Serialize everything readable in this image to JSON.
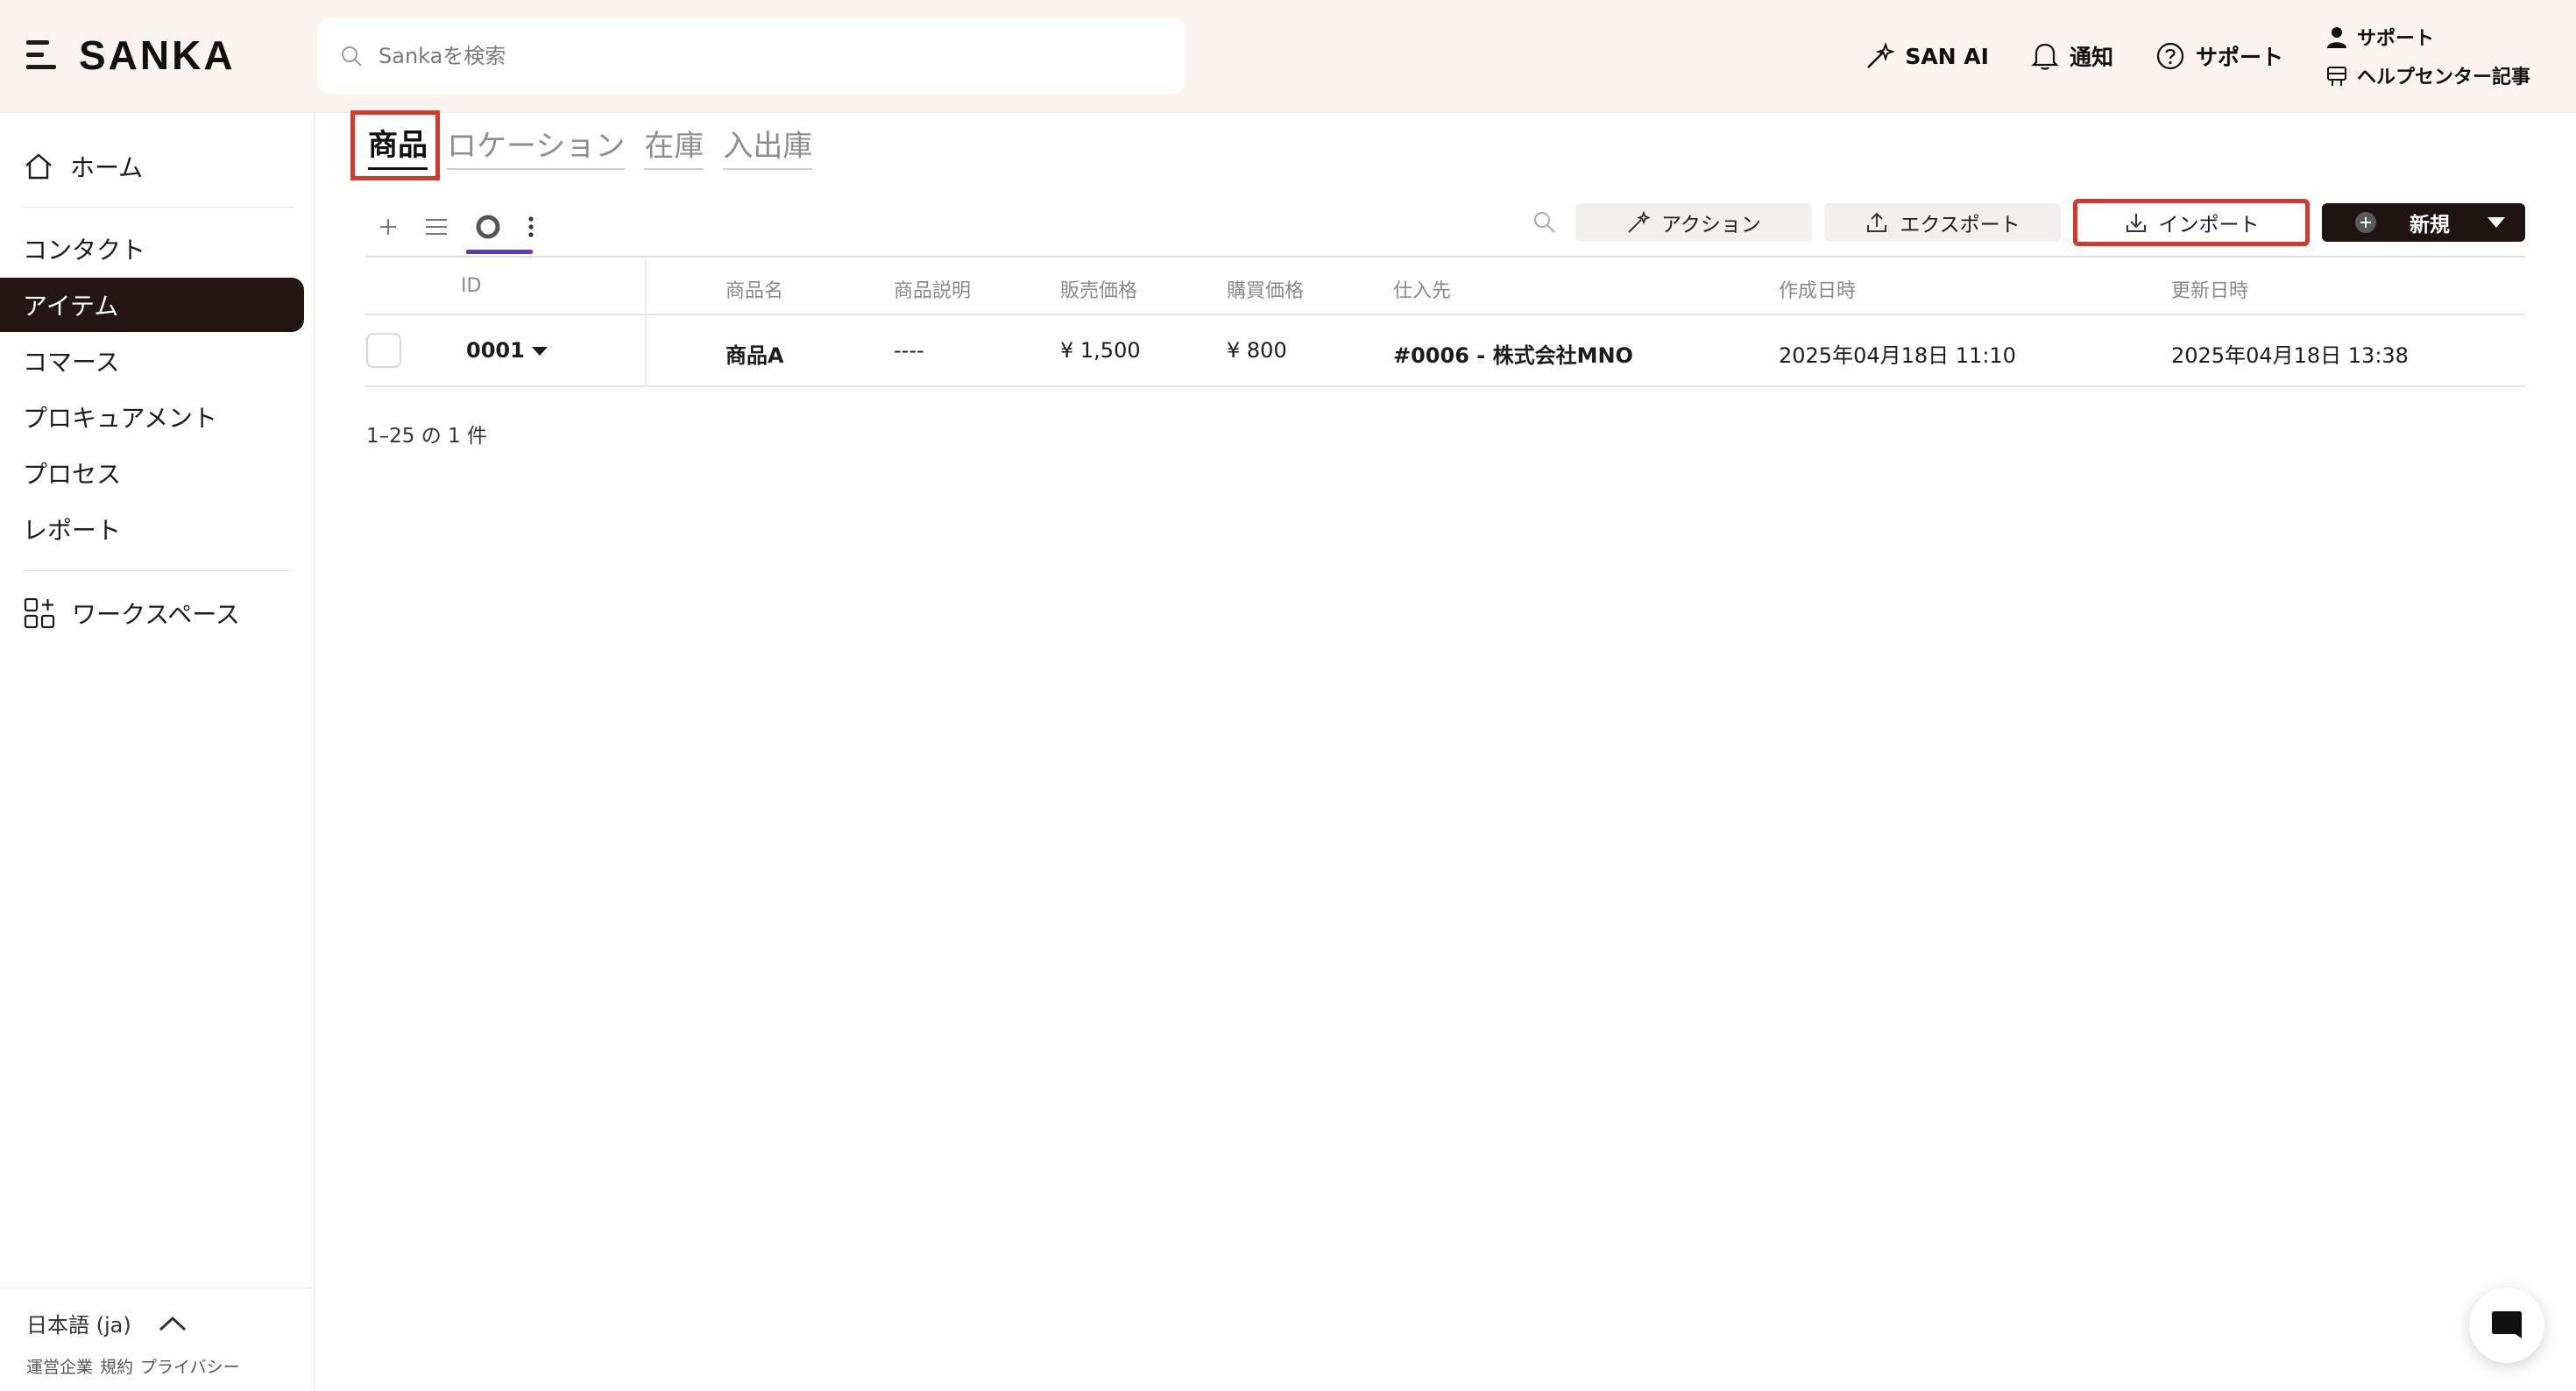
{
  "app": {
    "brand": "SANKA"
  },
  "search": {
    "placeholder": "Sankaを検索"
  },
  "header": {
    "san_ai": "SAN AI",
    "notifications": "通知",
    "support": "サポート",
    "support_user": "サポート",
    "help_center": "ヘルプセンター記事"
  },
  "sidebar": {
    "home": "ホーム",
    "items": [
      "コンタクト",
      "アイテム",
      "コマース",
      "プロキュアメント",
      "プロセス",
      "レポート"
    ],
    "active_item": "アイテム",
    "workspace": "ワークスペース",
    "language": "日本語 (ja)",
    "footer_links": [
      "運営企業",
      "規約",
      "プライバシー"
    ]
  },
  "tabs": [
    "商品",
    "ロケーション",
    "在庫",
    "入出庫"
  ],
  "active_tab": "商品",
  "toolbar": {
    "action_label": "アクション",
    "export_label": "エクスポート",
    "import_label": "インポート",
    "new_label": "新規"
  },
  "table": {
    "columns": [
      "ID",
      "商品名",
      "商品説明",
      "販売価格",
      "購買価格",
      "仕入先",
      "作成日時",
      "更新日時"
    ],
    "rows": [
      {
        "id": "0001",
        "name": "商品A",
        "description": "----",
        "sale_price": "¥ 1,500",
        "purchase_price": "¥ 800",
        "supplier": "#0006 - 株式会社MNO",
        "created_at": "2025年04月18日 11:10",
        "updated_at": "2025年04月18日 13:38"
      }
    ]
  },
  "pagination": "1–25 の 1 件",
  "colors": {
    "accent": "#5b3cc4",
    "highlight": "#d33a2c",
    "dark": "#231614",
    "header_bg": "#fbf3f0"
  }
}
